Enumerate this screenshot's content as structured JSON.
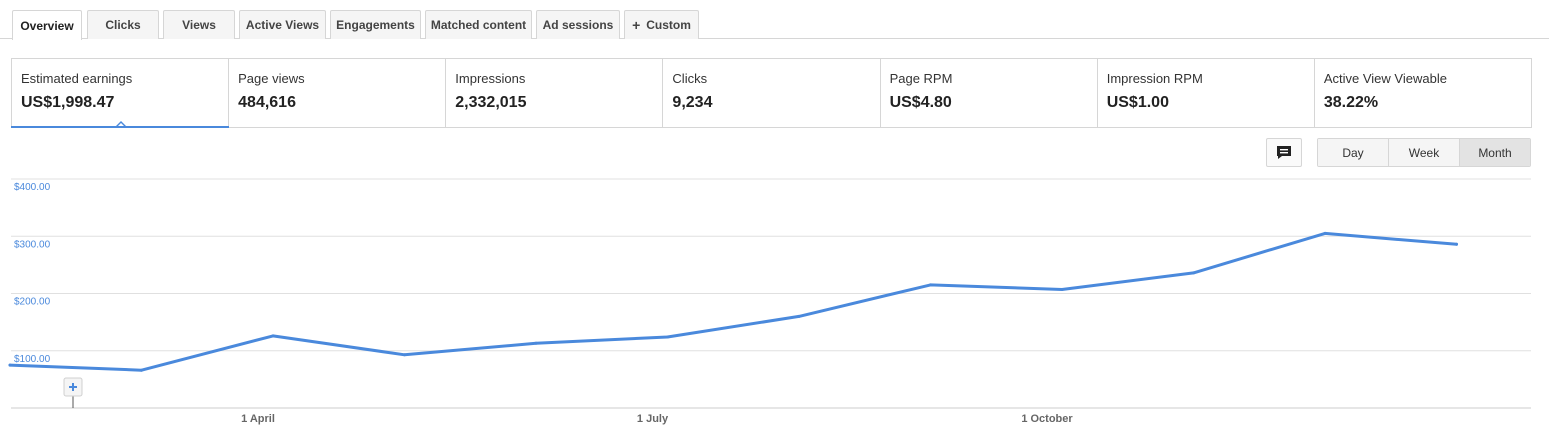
{
  "tabs": [
    {
      "label": "Overview",
      "active": true
    },
    {
      "label": "Clicks"
    },
    {
      "label": "Views"
    },
    {
      "label": "Active Views"
    },
    {
      "label": "Engagements"
    },
    {
      "label": "Matched content"
    },
    {
      "label": "Ad sessions"
    },
    {
      "label": "Custom",
      "icon": "plus-icon",
      "prefix": "+"
    }
  ],
  "metrics": [
    {
      "label": "Estimated earnings",
      "value": "US$1,998.47",
      "active": true
    },
    {
      "label": "Page views",
      "value": "484,616"
    },
    {
      "label": "Impressions",
      "value": "2,332,015"
    },
    {
      "label": "Clicks",
      "value": "9,234"
    },
    {
      "label": "Page RPM",
      "value": "US$4.80"
    },
    {
      "label": "Impression RPM",
      "value": "US$1.00"
    },
    {
      "label": "Active View Viewable",
      "value": "38.22%"
    }
  ],
  "controls": {
    "comment_icon": "comment-icon",
    "periods": [
      {
        "label": "Day"
      },
      {
        "label": "Week"
      },
      {
        "label": "Month",
        "selected": true
      }
    ]
  },
  "colors": {
    "line": "#4a89dc",
    "grid": "#e0e0e0",
    "border": "#d6d6d6"
  },
  "chart_data": {
    "type": "line",
    "ylim": [
      0,
      400
    ],
    "y_ticks": [
      "$100.00",
      "$200.00",
      "$300.00",
      "$400.00"
    ],
    "y_tick_values": [
      100,
      200,
      300,
      400
    ],
    "x_ticks": [
      "1 April",
      "1 July",
      "1 October"
    ],
    "x_tick_indices": [
      2,
      5,
      8
    ],
    "grid": true,
    "series": [
      {
        "values": [
          75,
          66,
          126,
          93,
          113,
          124,
          160,
          215,
          207,
          236,
          305,
          286
        ]
      }
    ]
  }
}
